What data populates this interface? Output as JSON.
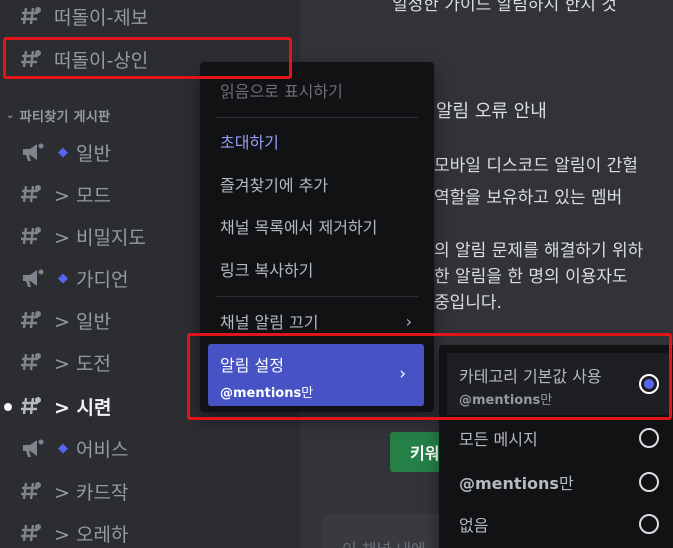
{
  "sidebar": {
    "channels_top": [
      {
        "name": "떠돌이-제보"
      },
      {
        "name": "떠돌이-상인"
      }
    ],
    "category": {
      "label": "파티찾기 게시판"
    },
    "forum_channels": [
      {
        "name": "일반",
        "icon": "megaphone-icon",
        "diamond": "◆"
      },
      {
        "name": "> 모드",
        "icon": "hash-thread-icon"
      },
      {
        "name": "> 비밀지도",
        "icon": "hash-thread-icon"
      },
      {
        "name": "가디언",
        "icon": "megaphone-icon",
        "diamond": "◆"
      },
      {
        "name": "> 일반",
        "icon": "hash-thread-icon"
      },
      {
        "name": "> 도전",
        "icon": "hash-thread-icon"
      },
      {
        "name": "> 시련",
        "icon": "hash-thread-icon",
        "active": true
      },
      {
        "name": "어비스",
        "icon": "megaphone-icon",
        "diamond": "◆"
      },
      {
        "name": "> 카드작",
        "icon": "hash-thread-icon"
      },
      {
        "name": "> 오레하",
        "icon": "hash-thread-icon"
      }
    ]
  },
  "main": {
    "lines": [
      "알림 오류 안내",
      "모바일 디스코드 알림이 간헐",
      "역할을 보유하고 있는 멤버",
      "의 알림 문제를 해결하기 위하",
      "한 알림을 한 명의 이용자도",
      "중입니다."
    ],
    "top_partial": "일정한 가이드 알림하시 한지 것",
    "keyword_button": "키워",
    "input_placeholder": "이 채널 내에"
  },
  "context_menu": {
    "items": [
      {
        "label": "읽음으로 표시하기",
        "state": "disabled"
      },
      {
        "label": "초대하기",
        "state": "accent"
      },
      {
        "label": "즐겨찾기에 추가"
      },
      {
        "label": "채널 목록에서 제거하기"
      },
      {
        "label": "링크 복사하기"
      },
      {
        "label": "채널 알림 끄기",
        "has_arrow": true
      }
    ],
    "selected": {
      "label": "알림 설정",
      "sub_bold": "@mentions",
      "sub_rest": "만"
    },
    "arrow": "›"
  },
  "submenu": {
    "options": [
      {
        "label": "카테고리 기본값 사용",
        "sub_bold": "@mentions",
        "sub_rest": "만",
        "checked": true
      },
      {
        "label": "모든 메시지",
        "checked": false
      },
      {
        "label_bold": "@mentions",
        "label_rest": "만",
        "checked": false
      },
      {
        "label": "없음",
        "checked": false
      }
    ]
  },
  "colors": {
    "highlight": "#e0151a",
    "accent": "#5865f2",
    "selected_bg": "#4752c4",
    "green": "#248046"
  }
}
